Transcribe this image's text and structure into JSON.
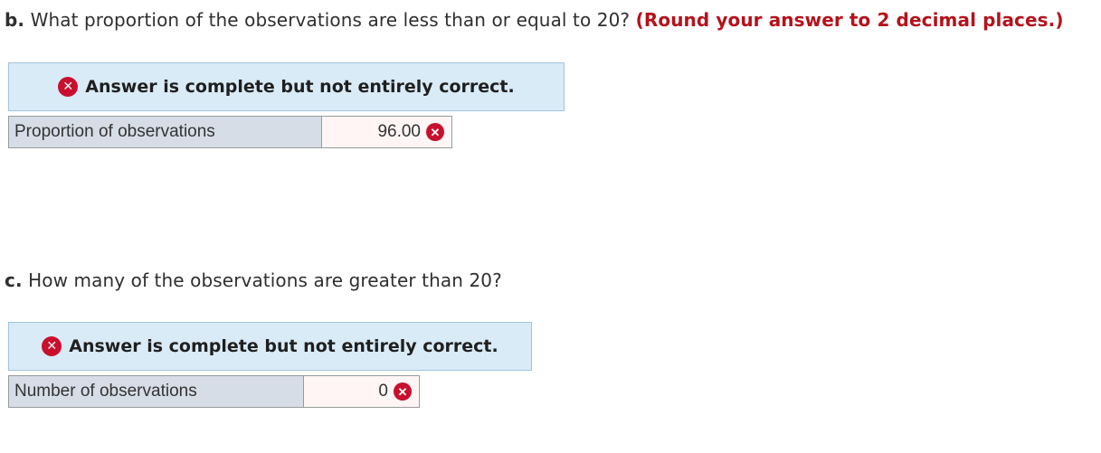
{
  "part_b": {
    "letter": "b.",
    "question": "What proportion of the observations are less than or equal to 20?",
    "note": "(Round your answer to 2 decimal places.)",
    "feedback": "Answer is complete but not entirely correct.",
    "row_label": "Proportion of observations",
    "value": "96.00"
  },
  "part_c": {
    "letter": "c.",
    "question": "How many of the observations are greater than 20?",
    "feedback": "Answer is complete but not entirely correct.",
    "row_label": "Number of observations",
    "value": "0"
  },
  "icons": {
    "incorrect_glyph": "✕",
    "incorrect_icon_name": "incorrect-icon",
    "incorrect_color": "#c8102e"
  },
  "colors": {
    "note_red": "#b5121b",
    "banner_bg": "#d9ebf7",
    "label_bg": "#d7dde6",
    "value_bg": "#fff5f5"
  }
}
